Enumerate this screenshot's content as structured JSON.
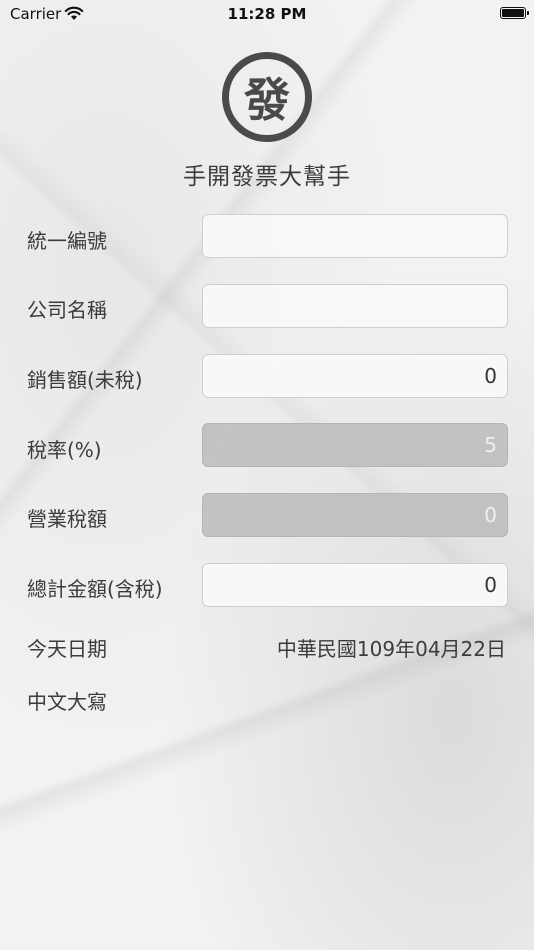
{
  "status_bar": {
    "carrier": "Carrier",
    "time": "11:28 PM",
    "icons": [
      "wifi-icon",
      "battery-icon"
    ]
  },
  "app": {
    "logo_char": "發",
    "title": "手開發票大幫手"
  },
  "form": {
    "tax_id": {
      "label": "統一編號",
      "value": ""
    },
    "company_name": {
      "label": "公司名稱",
      "value": ""
    },
    "sales_amount": {
      "label": "銷售額(未稅)",
      "value": "0"
    },
    "tax_rate": {
      "label": "稅率(%)",
      "value": "5"
    },
    "business_tax": {
      "label": "營業稅額",
      "value": "0"
    },
    "total_amount": {
      "label": "總計金額(含稅)",
      "value": "0"
    },
    "today_date": {
      "label": "今天日期",
      "value": "中華民國109年04月22日"
    },
    "chinese_capital": {
      "label": "中文大寫",
      "value": ""
    }
  },
  "colors": {
    "text": "#3c3c3c",
    "logo": "#4a4a4a",
    "field_bg": "#f9f9f9",
    "field_disabled_bg": "#bebebe",
    "field_disabled_text": "#efefef"
  }
}
